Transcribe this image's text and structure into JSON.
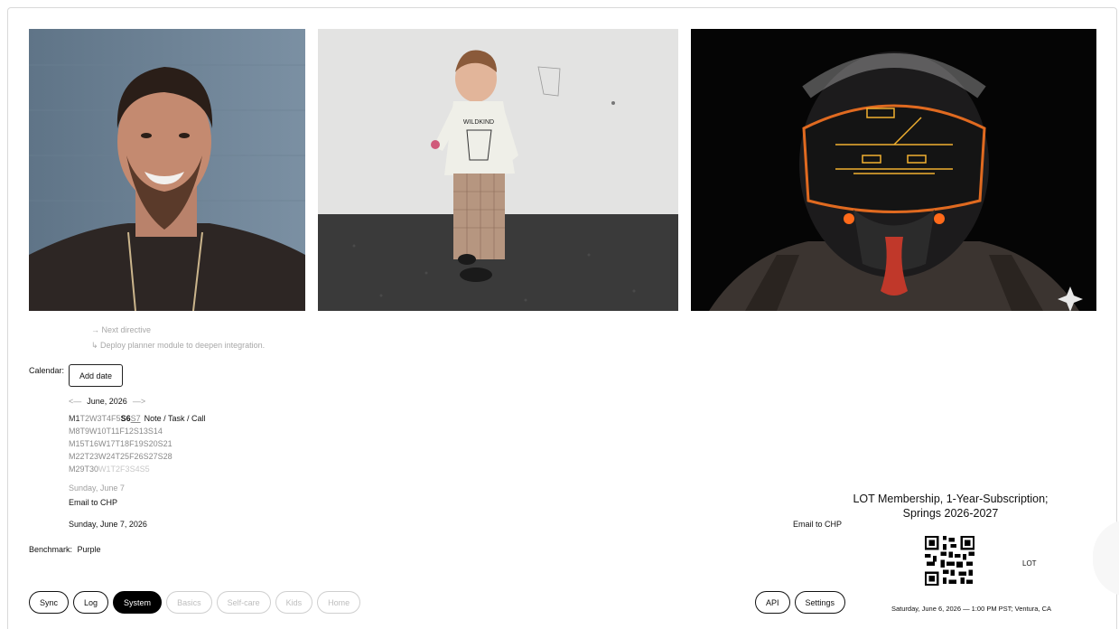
{
  "directive": {
    "next": "→ Next directive",
    "detail": "↳ Deploy planner module to deepen integration."
  },
  "calendar": {
    "label": "Calendar:",
    "add_date_label": "Add date",
    "prev_arrow": "<—",
    "month": "June, 2026",
    "next_arrow": "—>",
    "weeks": [
      [
        "M1",
        "T2",
        "W3",
        "T4",
        "F5",
        "S6",
        "S7"
      ],
      [
        "M8",
        "T9",
        "W10",
        "T11",
        "F12",
        "S13",
        "S14"
      ],
      [
        "M15",
        "T16",
        "W17",
        "T18",
        "F19",
        "S20",
        "S21"
      ],
      [
        "M22",
        "T23",
        "W24",
        "T25",
        "F26",
        "S27",
        "S28"
      ],
      [
        "M29",
        "T30",
        "W1",
        "T2",
        "F3",
        "S4",
        "S5"
      ]
    ],
    "day_note": "Note / Task / Call",
    "selected_short": "Sunday, June 7",
    "email_left": "Email to CHP",
    "selected_full": "Sunday, June 7, 2026"
  },
  "benchmark": {
    "label": "Benchmark:",
    "value": "Purple"
  },
  "nav": {
    "left": [
      {
        "label": "Sync",
        "state": "normal"
      },
      {
        "label": "Log",
        "state": "normal"
      },
      {
        "label": "System",
        "state": "active"
      },
      {
        "label": "Basics",
        "state": "disabled"
      },
      {
        "label": "Self-care",
        "state": "disabled"
      },
      {
        "label": "Kids",
        "state": "disabled"
      },
      {
        "label": "Home",
        "state": "disabled"
      }
    ],
    "right": [
      {
        "label": "API",
        "state": "normal"
      },
      {
        "label": "Settings",
        "state": "normal"
      }
    ]
  },
  "membership": {
    "line1": "LOT Membership, 1-Year-Subscription;",
    "line2": "Springs 2026-2027",
    "email_right": "Email to CHP",
    "qr_label": "LOT",
    "footer": "Saturday, June 6, 2026 — 1:00 PM PST; Ventura, CA"
  },
  "colors": {
    "accent_active": "#000000",
    "disabled_text": "#bdbdbd",
    "muted_text": "#8a8a8a"
  }
}
